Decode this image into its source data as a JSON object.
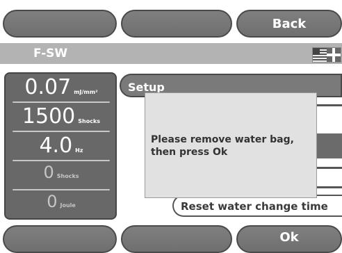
{
  "top_buttons": {
    "left": "",
    "middle": "",
    "back": "Back"
  },
  "header": {
    "title": "F-SW",
    "language_icon": "flag-us-uk-icon"
  },
  "readouts": [
    {
      "value": "0.07",
      "unit": "mJ/mm²"
    },
    {
      "value": "1500",
      "unit": "Shocks"
    },
    {
      "value": "4.0",
      "unit": "Hz"
    },
    {
      "value": "0",
      "unit": "Shocks"
    },
    {
      "value": "0",
      "unit": "Joule"
    }
  ],
  "menu": {
    "setup_label": "Setup",
    "reset_label": "Reset water change time"
  },
  "dialog": {
    "message": "Please remove water bag,\nthen press Ok"
  },
  "bottom_buttons": {
    "left": "",
    "middle": "",
    "ok": "Ok"
  }
}
